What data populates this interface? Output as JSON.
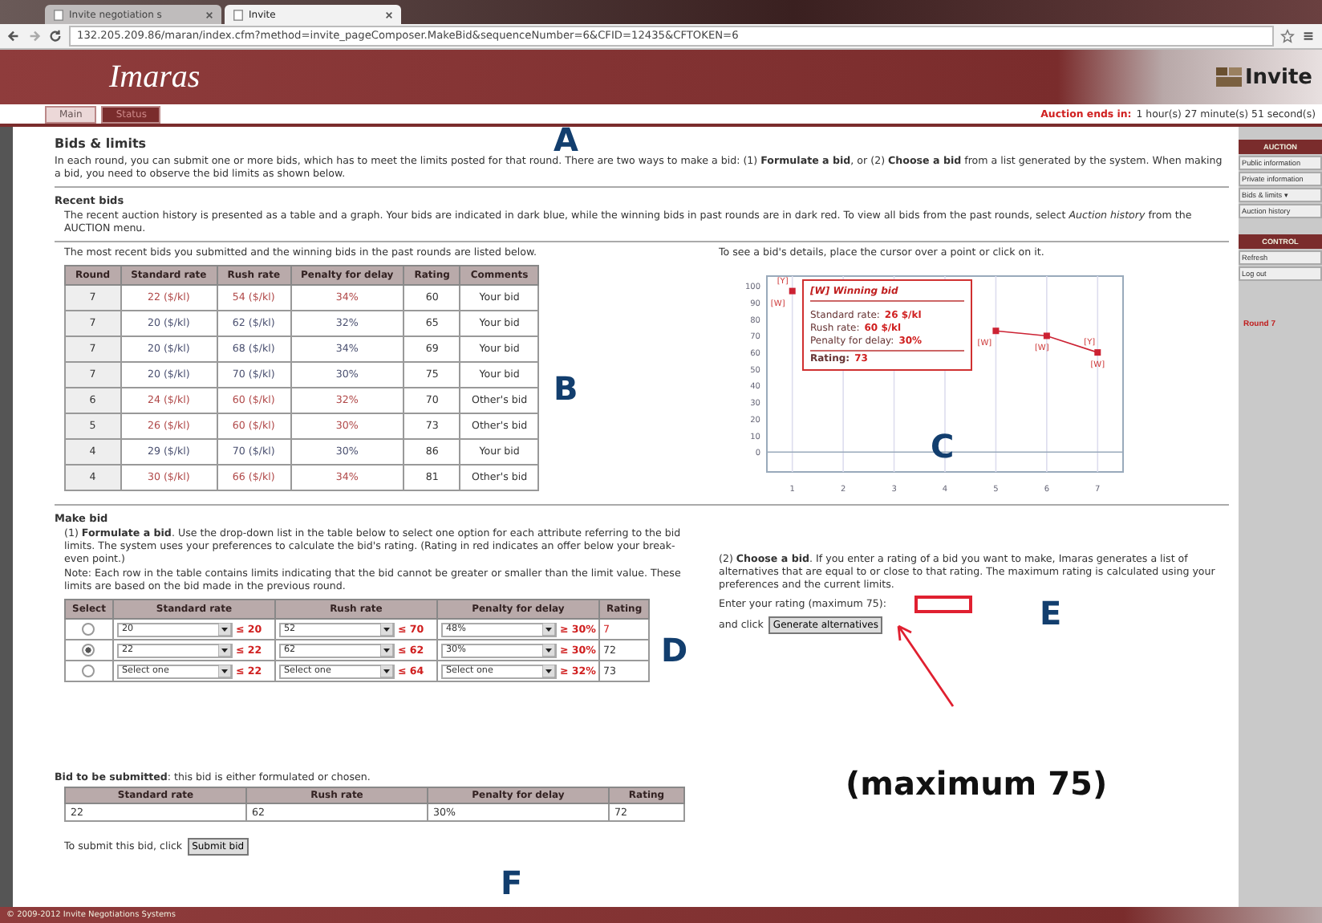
{
  "browser": {
    "tabs": [
      {
        "label": "Invite negotiation s",
        "selected": false
      },
      {
        "label": "Invite",
        "selected": true
      }
    ],
    "address": "132.205.209.86/maran/index.cfm?method=invite_pageComposer.MakeBid&sequenceNumber=6&CFID=12435&CFTOKEN=6"
  },
  "header": {
    "app_name": "Imaras",
    "brand": "Invite"
  },
  "tabs": [
    {
      "label": "Main",
      "selected": false
    },
    {
      "label": "Status",
      "selected": true
    }
  ],
  "auction_timer": {
    "label": "Auction ends in:",
    "value": "1 hour(s) 27 minute(s) 51 second(s)"
  },
  "page_title": "Bids & limits",
  "intro": "In each round, you can submit one or more bids, which has to meet the limits posted for that round. There are two ways to make a bid: (1) **Formulate a bid**, or (2) **Choose a bid** from a list generated by the system. When making a bid, you need to observe the bid limits as shown below.",
  "recent_bids": {
    "heading": "Recent bids",
    "description": "The recent auction history is presented as a table and a graph. Your bids are indicated in dark blue, while the winning bids in past rounds are in dark red. To view all bids from the past rounds, select *Auction history* from the AUCTION menu.",
    "table_caption": "The most recent bids you submitted and the winning bids in the past rounds are listed below.",
    "columns": [
      "Round",
      "Standard rate",
      "Rush rate",
      "Penalty for delay",
      "Rating",
      "Comments"
    ],
    "rows": [
      {
        "color": "#b04848",
        "cells": [
          "7",
          "22 ($/kl)",
          "54 ($/kl)",
          "34%",
          "60",
          "Your bid"
        ]
      },
      {
        "color": "#4a5070",
        "cells": [
          "7",
          "20 ($/kl)",
          "62 ($/kl)",
          "32%",
          "65",
          "Your bid"
        ]
      },
      {
        "color": "#4a5070",
        "cells": [
          "7",
          "20 ($/kl)",
          "68 ($/kl)",
          "34%",
          "69",
          "Your bid"
        ]
      },
      {
        "color": "#4a5070",
        "cells": [
          "7",
          "20 ($/kl)",
          "70 ($/kl)",
          "30%",
          "75",
          "Your bid"
        ]
      },
      {
        "color": "#b04848",
        "cells": [
          "6",
          "24 ($/kl)",
          "60 ($/kl)",
          "32%",
          "70",
          "Other's bid"
        ]
      },
      {
        "color": "#b04848",
        "cells": [
          "5",
          "26 ($/kl)",
          "60 ($/kl)",
          "30%",
          "73",
          "Other's bid"
        ]
      },
      {
        "color": "#4a5070",
        "cells": [
          "4",
          "29 ($/kl)",
          "70 ($/kl)",
          "30%",
          "86",
          "Your bid"
        ]
      },
      {
        "color": "#b04848",
        "cells": [
          "4",
          "30 ($/kl)",
          "66 ($/kl)",
          "34%",
          "81",
          "Other's bid"
        ]
      }
    ]
  },
  "chart": {
    "caption": "To see a bid's details, place the cursor over a point or click on it.",
    "chart_data": {
      "type": "line",
      "x": [
        1,
        2,
        3,
        4,
        5,
        6,
        7
      ],
      "series": [
        {
          "color": "#cc2233",
          "marker": true,
          "values": [
            97,
            null,
            null,
            null,
            73,
            70,
            60
          ]
        }
      ],
      "xlim": [
        0.5,
        7.5
      ],
      "ylim": [
        -12,
        106
      ],
      "grid": true,
      "xticks": [
        1,
        2,
        3,
        4,
        5,
        6,
        7
      ],
      "yticks": [
        0,
        10,
        20,
        30,
        40,
        50,
        60,
        70,
        80,
        90,
        100
      ],
      "annotations": [
        {
          "x": 1,
          "y": 97,
          "text": "[Y]"
        },
        {
          "x": 1,
          "y": 97,
          "text": "[W]"
        },
        {
          "x": 5,
          "y": 73,
          "text": "[W]"
        },
        {
          "x": 6,
          "y": 70,
          "text": "[W]"
        },
        {
          "x": 7,
          "y": 60,
          "text": "[Y]"
        },
        {
          "x": 7,
          "y": 60,
          "text": "[W]"
        }
      ]
    },
    "tooltip": {
      "title": "[W] Winning bid",
      "lines": [
        {
          "label": "Standard rate:",
          "value": "26 $/kl"
        },
        {
          "label": "Rush rate:",
          "value": "60 $/kl"
        },
        {
          "label": "Penalty for delay:",
          "value": "30%"
        }
      ],
      "rating_label": "Rating:",
      "rating_value": "73"
    }
  },
  "make_bid": {
    "heading": "Make bid",
    "formulate": {
      "text": "(1) **Formulate a bid**. Use the drop-down list in the table below to select one option for each attribute referring to the bid limits. The system uses your preferences to calculate the bid's rating. (Rating in red indicates an offer below your break-even point.)",
      "note": "Note: Each row in the table contains limits indicating that the bid cannot be greater or smaller than the limit value. These limits are based on the bid made in the previous round.",
      "columns": [
        "Select",
        "Standard rate",
        "Rush rate",
        "Penalty for delay",
        "Rating"
      ],
      "rows": [
        {
          "selected": false,
          "fields": [
            {
              "value": "20",
              "limit": "≤ 20"
            },
            {
              "value": "52",
              "limit": "≤ 70"
            },
            {
              "value": "48%",
              "limit": "≥ 30%"
            }
          ],
          "rating": "7",
          "below_break_even": true
        },
        {
          "selected": true,
          "fields": [
            {
              "value": "22",
              "limit": "≤ 22"
            },
            {
              "value": "62",
              "limit": "≤ 62"
            },
            {
              "value": "30%",
              "limit": "≥ 30%"
            }
          ],
          "rating": "72",
          "below_break_even": false
        },
        {
          "selected": false,
          "fields": [
            {
              "value": "Select one",
              "limit": "≤ 22"
            },
            {
              "value": "Select one",
              "limit": "≤ 64"
            },
            {
              "value": "Select one",
              "limit": "≥ 32%"
            }
          ],
          "rating": "73",
          "below_break_even": false
        }
      ]
    },
    "choose": {
      "text": "(2) **Choose a bid**. If you enter a rating of a bid you want to make, Imaras generates a list of alternatives that are equal to or close to that rating. The maximum rating is calculated using your preferences and the current limits.",
      "rating_label": "Enter your rating (maximum 75):",
      "click_label": "and click",
      "button": "Generate alternatives"
    }
  },
  "submission": {
    "label": "**Bid to be submitted**: this bid is either formulated or chosen.",
    "columns": [
      "Standard rate",
      "Rush rate",
      "Penalty for delay",
      "Rating"
    ],
    "values": [
      "22",
      "62",
      "30%",
      "72"
    ],
    "submit_text": "To submit this bid, click",
    "submit_button": "Submit bid"
  },
  "sidebar": {
    "sections": [
      {
        "title": "AUCTION",
        "items": [
          "Public information",
          "Private information",
          "Bids & limits ▾",
          "Auction history"
        ]
      },
      {
        "title": "CONTROL",
        "items": [
          "Refresh",
          "Log out"
        ]
      }
    ],
    "round": "Round 7"
  },
  "footer": "© 2009-2012 Invite Negotiations Systems",
  "annotations": {
    "letters": [
      "A",
      "B",
      "C",
      "D",
      "E",
      "F"
    ],
    "callout": "(maximum 75)"
  }
}
